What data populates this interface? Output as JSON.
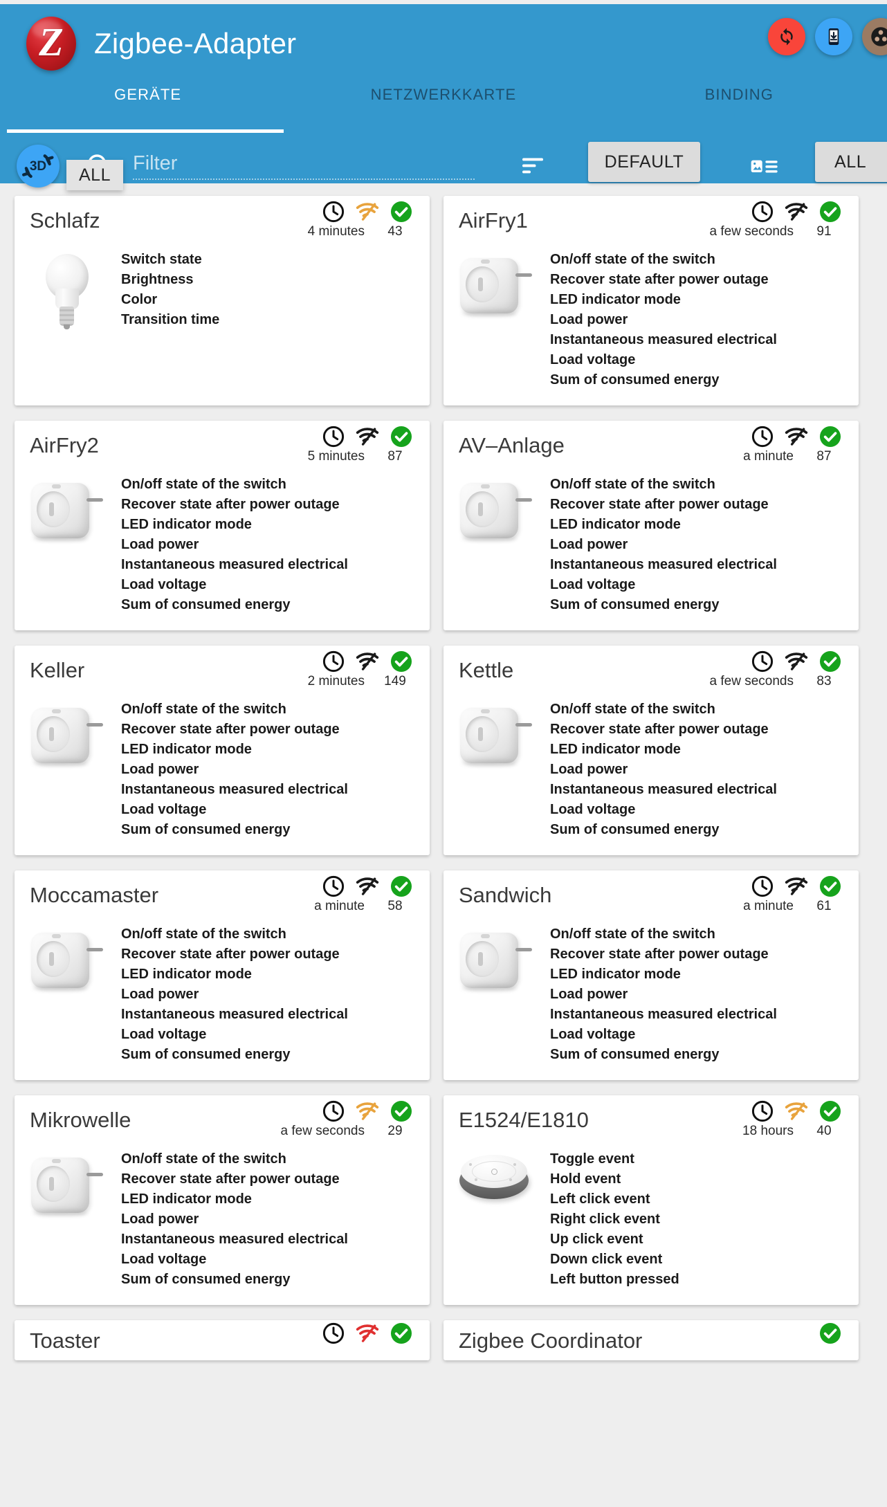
{
  "header": {
    "app_title": "Zigbee-Adapter",
    "logo_letter": "Z",
    "actions": [
      {
        "name": "refresh-button",
        "icon": "sync-icon",
        "color": "#f9453a"
      },
      {
        "name": "add-device-button",
        "icon": "phone-download-icon",
        "color": "#3da5f5"
      },
      {
        "name": "network-button",
        "icon": "hub-icon",
        "color": "#9b7b63"
      }
    ]
  },
  "tabs": [
    {
      "label": "GERÄTE",
      "active": true
    },
    {
      "label": "NETZWERKKARTE",
      "active": false
    },
    {
      "label": "BINDING",
      "active": false
    }
  ],
  "toolbar": {
    "btn_3d_label": "3D",
    "search_icon": "search-icon",
    "filter_value": "",
    "filter_placeholder": "Filter",
    "sort_icon": "sort-icon",
    "default_button": "DEFAULT",
    "viewmode_icon": "image-list-icon",
    "all_button": "ALL"
  },
  "tooltip": {
    "text": "ALL"
  },
  "devices": [
    {
      "name": "Schlafz",
      "time": "4 minutes",
      "lqi": "43",
      "signal_color": "#e8a33d",
      "status_ok": true,
      "thumb": "bulb",
      "states": [
        "Switch state",
        "Brightness",
        "Color",
        "Transition time"
      ]
    },
    {
      "name": "AirFry1",
      "time": "a few seconds",
      "lqi": "91",
      "signal_color": "#1a1a1a",
      "status_ok": true,
      "thumb": "plug",
      "states": [
        "On/off state of the switch",
        "Recover state after power outage",
        "LED indicator mode",
        "Load power",
        "Instantaneous measured electrical",
        "Load voltage",
        "Sum of consumed energy"
      ]
    },
    {
      "name": "AirFry2",
      "time": "5 minutes",
      "lqi": "87",
      "signal_color": "#1a1a1a",
      "status_ok": true,
      "thumb": "plug",
      "states": [
        "On/off state of the switch",
        "Recover state after power outage",
        "LED indicator mode",
        "Load power",
        "Instantaneous measured electrical",
        "Load voltage",
        "Sum of consumed energy"
      ]
    },
    {
      "name": "AV–Anlage",
      "time": "a minute",
      "lqi": "87",
      "signal_color": "#1a1a1a",
      "status_ok": true,
      "thumb": "plug",
      "states": [
        "On/off state of the switch",
        "Recover state after power outage",
        "LED indicator mode",
        "Load power",
        "Instantaneous measured electrical",
        "Load voltage",
        "Sum of consumed energy"
      ]
    },
    {
      "name": "Keller",
      "time": "2 minutes",
      "lqi": "149",
      "signal_color": "#1a1a1a",
      "status_ok": true,
      "thumb": "plug",
      "states": [
        "On/off state of the switch",
        "Recover state after power outage",
        "LED indicator mode",
        "Load power",
        "Instantaneous measured electrical",
        "Load voltage",
        "Sum of consumed energy"
      ]
    },
    {
      "name": "Kettle",
      "time": "a few seconds",
      "lqi": "83",
      "signal_color": "#1a1a1a",
      "status_ok": true,
      "thumb": "plug",
      "states": [
        "On/off state of the switch",
        "Recover state after power outage",
        "LED indicator mode",
        "Load power",
        "Instantaneous measured electrical",
        "Load voltage",
        "Sum of consumed energy"
      ]
    },
    {
      "name": "Moccamaster",
      "time": "a minute",
      "lqi": "58",
      "signal_color": "#1a1a1a",
      "status_ok": true,
      "thumb": "plug",
      "states": [
        "On/off state of the switch",
        "Recover state after power outage",
        "LED indicator mode",
        "Load power",
        "Instantaneous measured electrical",
        "Load voltage",
        "Sum of consumed energy"
      ]
    },
    {
      "name": "Sandwich",
      "time": "a minute",
      "lqi": "61",
      "signal_color": "#1a1a1a",
      "status_ok": true,
      "thumb": "plug",
      "states": [
        "On/off state of the switch",
        "Recover state after power outage",
        "LED indicator mode",
        "Load power",
        "Instantaneous measured electrical",
        "Load voltage",
        "Sum of consumed energy"
      ]
    },
    {
      "name": "Mikrowelle",
      "time": "a few seconds",
      "lqi": "29",
      "signal_color": "#e8a33d",
      "status_ok": true,
      "thumb": "plug",
      "states": [
        "On/off state of the switch",
        "Recover state after power outage",
        "LED indicator mode",
        "Load power",
        "Instantaneous measured electrical",
        "Load voltage",
        "Sum of consumed energy"
      ]
    },
    {
      "name": "E1524/E1810",
      "time": "18 hours",
      "lqi": "40",
      "signal_color": "#e8a33d",
      "status_ok": true,
      "thumb": "puck",
      "states": [
        "Toggle event",
        "Hold event",
        "Left click event",
        "Right click event",
        "Up click event",
        "Down click event",
        "Left button pressed"
      ]
    },
    {
      "name": "Toaster",
      "time": "",
      "lqi": "",
      "signal_color": "#e03030",
      "status_ok": true,
      "thumb": "plug",
      "states": [],
      "compact": true,
      "show_clock": true
    },
    {
      "name": "Zigbee Coordinator",
      "time": "",
      "lqi": "",
      "signal_color": "",
      "status_ok": true,
      "thumb": "none",
      "states": [],
      "compact": true,
      "show_clock": false
    }
  ]
}
